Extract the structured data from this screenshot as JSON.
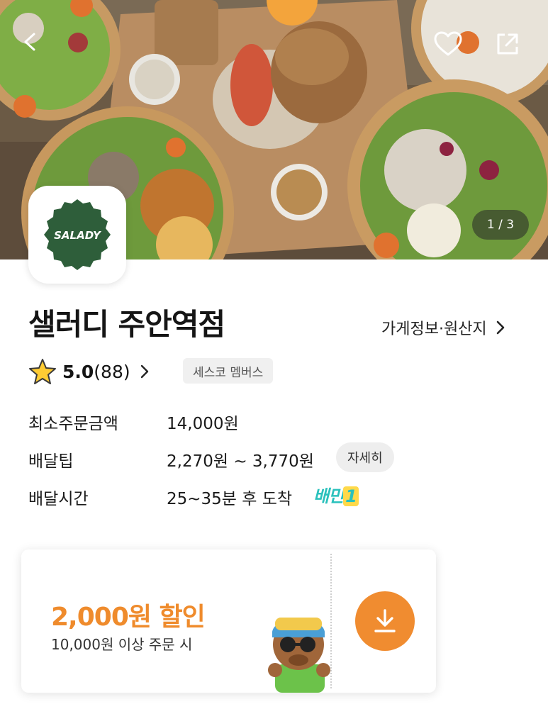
{
  "hero": {
    "page_indicator": "1 / 3",
    "icons": {
      "back": "arrow-left-icon",
      "like": "heart-outline-icon",
      "share": "share-external-icon"
    }
  },
  "logo": {
    "text": "SALADY",
    "color": "#2e5e3a"
  },
  "store": {
    "name": "샐러디 주안역점",
    "info_link": "가게정보·원산지"
  },
  "rating": {
    "score": "5.0",
    "count": "(88)",
    "member_badge": "세스코 멤버스"
  },
  "info": {
    "min_order_label": "최소주문금액",
    "min_order_value": "14,000원",
    "delivery_tip_label": "배달팁",
    "delivery_tip_value": "2,270원 ~ 3,770원",
    "detail_button": "자세히",
    "delivery_time_label": "배달시간",
    "delivery_time_value": "25~35분 후 도착",
    "baemin_one_text": "배민",
    "baemin_one_num": "1"
  },
  "coupon": {
    "amount": "2,000원 할인",
    "condition": "10,000원 이상 주문 시",
    "accent": "#f08c30"
  }
}
